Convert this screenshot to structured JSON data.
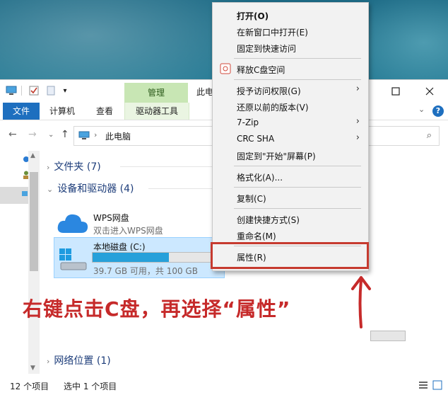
{
  "window": {
    "title_partial": "此电",
    "context_tab_header": "管理",
    "ribbon_tabs": [
      "文件",
      "计算机",
      "查看",
      "驱动器工具"
    ]
  },
  "address": {
    "path": "此电脑"
  },
  "groups": [
    {
      "label": "文件夹 (7)",
      "expanded": false
    },
    {
      "label": "设备和驱动器 (4)",
      "expanded": true
    },
    {
      "label": "网络位置 (1)",
      "expanded": false
    }
  ],
  "items": {
    "wps": {
      "title": "WPS网盘",
      "subtitle": "双击进入WPS网盘"
    },
    "drive_c": {
      "title": "本地磁盘 (C:)",
      "usage": "39.7 GB 可用，共 100 GB",
      "used_fraction": 0.6
    }
  },
  "status": {
    "count": "12 个项目",
    "selected": "选中 1 个项目"
  },
  "context_menu": {
    "items": [
      {
        "label": "打开(O)",
        "bold": true
      },
      {
        "label": "在新窗口中打开(E)"
      },
      {
        "label": "固定到快速访问"
      },
      {
        "label": "释放C盘空间",
        "icon": "wps-clean-icon"
      },
      {
        "label": "授予访问权限(G)",
        "submenu": true
      },
      {
        "label": "还原以前的版本(V)"
      },
      {
        "label": "7-Zip",
        "submenu": true
      },
      {
        "label": "CRC SHA",
        "submenu": true
      },
      {
        "label": "固定到\"开始\"屏幕(P)"
      },
      {
        "label": "格式化(A)..."
      },
      {
        "label": "复制(C)"
      },
      {
        "label": "创建快捷方式(S)"
      },
      {
        "label": "重命名(M)"
      },
      {
        "label": "属性(R)"
      }
    ]
  },
  "annotation": "右键点击C盘，再选择“属性”",
  "colors": {
    "accent": "#1e6fbf",
    "highlight": "#c63a2f",
    "annotation": "#c62a2a",
    "context_tab": "#c8e6b4"
  }
}
